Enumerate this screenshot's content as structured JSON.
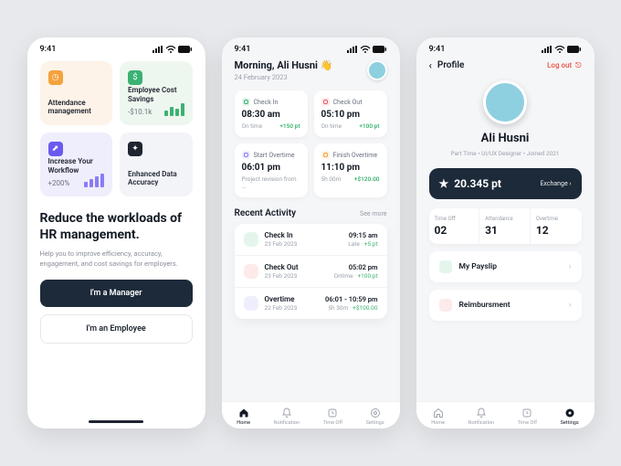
{
  "status_time": "9:41",
  "screen1": {
    "tiles": [
      {
        "label": "Attendance management"
      },
      {
        "label": "Employee Cost Savings",
        "value": "-$10.1k"
      },
      {
        "label": "Increase Your Workflow",
        "value": "+200%"
      },
      {
        "label": "Enhanced Data Accuracy"
      }
    ],
    "hero": "Reduce the workloads of HR management.",
    "sub": "Help you to improve efficiency, accuracy, engagement, and cost savings for employers.",
    "btn_manager": "I'm a Manager",
    "btn_employee": "I'm an Employee"
  },
  "screen2": {
    "greeting": "Morning, Ali Husni 👋",
    "date": "24 February 2023",
    "cards": [
      {
        "label": "Check In",
        "time": "08:30 am",
        "status": "On time",
        "points": "+150 pt"
      },
      {
        "label": "Check Out",
        "time": "05:10 pm",
        "status": "On time",
        "points": "+100 pt"
      },
      {
        "label": "Start Overtime",
        "time": "06:01 pm",
        "status": "Project revision from ...",
        "points": ""
      },
      {
        "label": "Finish Overtime",
        "time": "11:10 pm",
        "status": "5h 00m",
        "points": "+$120.00"
      }
    ],
    "recent_title": "Recent Activity",
    "see_more": "See more",
    "activities": [
      {
        "title": "Check In",
        "date": "23 Feb 2023",
        "right1": "09:15 am",
        "right2_a": "Late",
        "right2_b": "+5 pt"
      },
      {
        "title": "Check Out",
        "date": "23 Feb 2023",
        "right1": "05:02 pm",
        "right2_a": "Ontime",
        "right2_b": "+100 pt"
      },
      {
        "title": "Overtime",
        "date": "22 Feb 2023",
        "right1": "06:01 - 10:59 pm",
        "right2_a": "5h 30m",
        "right2_b": "+$100.00"
      }
    ],
    "tabs": {
      "home": "Home",
      "notif": "Notification",
      "timeoff": "Time Off",
      "settings": "Settings"
    }
  },
  "screen3": {
    "title": "Profile",
    "logout": "Log out",
    "name": "Ali Husni",
    "meta": "Part Time  •  UI/UX Designer  •  Joined 2021",
    "points": "20.345 pt",
    "exchange": "Exchange ›",
    "stats": [
      {
        "label": "Time Off",
        "value": "02"
      },
      {
        "label": "Attendance",
        "value": "31"
      },
      {
        "label": "Overtime",
        "value": "12"
      }
    ],
    "links": {
      "payslip": "My Payslip",
      "reimbursement": "Reimbursment"
    },
    "tabs": {
      "home": "Home",
      "notif": "Notification",
      "timeoff": "Time Off",
      "settings": "Settings"
    }
  }
}
